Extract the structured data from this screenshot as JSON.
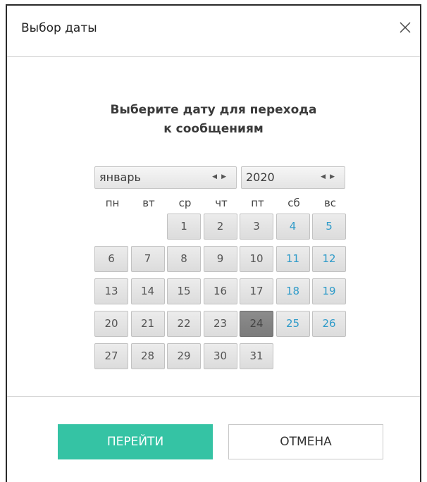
{
  "dialog": {
    "title": "Выбор даты",
    "close_icon": "close-icon",
    "prompt": "Выберите дату для перехода к сообщениям"
  },
  "calendar": {
    "month": "январь",
    "year": "2020",
    "month_nav_icons": [
      "arrow-left-icon",
      "arrow-right-icon"
    ],
    "weekdays": [
      "пн",
      "вт",
      "ср",
      "чт",
      "пт",
      "сб",
      "вс"
    ],
    "days": [
      "1",
      "2",
      "3",
      "4",
      "5",
      "6",
      "7",
      "8",
      "9",
      "10",
      "11",
      "12",
      "13",
      "14",
      "15",
      "16",
      "17",
      "18",
      "19",
      "20",
      "21",
      "22",
      "23",
      "24",
      "25",
      "26",
      "27",
      "28",
      "29",
      "30",
      "31"
    ],
    "first_weekday_index": 2,
    "selected_day": "24"
  },
  "buttons": {
    "go": "ПЕРЕЙТИ",
    "cancel": "ОТМЕНА"
  },
  "colors": {
    "accent": "#35c3a4",
    "weekend": "#2f9bc9",
    "selected_day": "#838383"
  }
}
